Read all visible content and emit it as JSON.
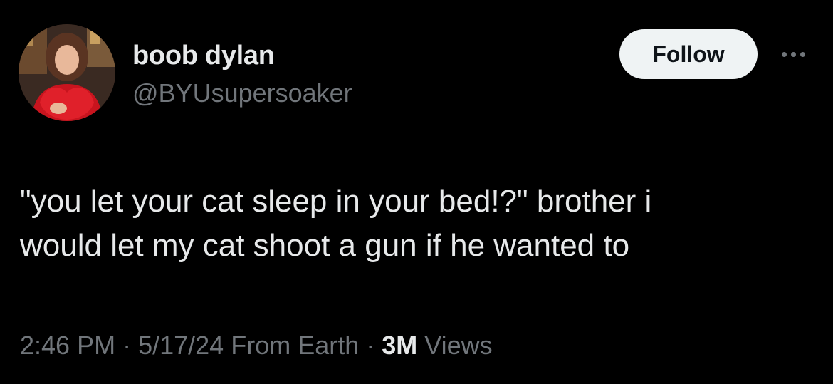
{
  "author": {
    "display_name": "boob dylan",
    "handle": "@BYUsupersoaker",
    "avatar_icon": "profile-photo"
  },
  "header": {
    "follow_label": "Follow",
    "more_icon": "ellipsis-icon"
  },
  "tweet": {
    "lines": [
      "\"you let your cat sleep in your bed!?\" brother i",
      "would let my cat shoot a gun if he wanted to"
    ]
  },
  "meta": {
    "time": "2:46 PM",
    "separator": " · ",
    "date": "5/17/24",
    "source": "From Earth",
    "views_count": "3M",
    "views_label": "Views"
  },
  "colors": {
    "background": "#000000",
    "primary_text": "#e7e9ea",
    "secondary_text": "#71767b",
    "follow_bg": "#eff3f4",
    "follow_text": "#0f1419"
  }
}
